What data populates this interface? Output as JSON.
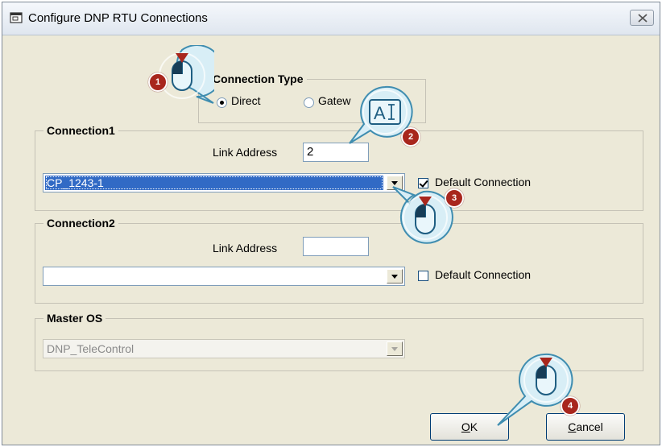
{
  "window": {
    "title": "Configure DNP RTU Connections",
    "title_icon": "dialog-icon",
    "close_icon": "close-icon"
  },
  "connection_type": {
    "legend": "Connection Type",
    "options": [
      {
        "label": "Direct",
        "checked": true
      },
      {
        "label": "Gatew",
        "checked": false
      }
    ]
  },
  "connection1": {
    "legend": "Connection1",
    "link_address_label": "Link Address",
    "link_address_value": "2",
    "combo_value": "CP_1243-1",
    "default_label": "Default Connection",
    "default_checked": true
  },
  "connection2": {
    "legend": "Connection2",
    "link_address_label": "Link Address",
    "link_address_value": "",
    "combo_value": "",
    "default_label": "Default Connection",
    "default_checked": false
  },
  "master_os": {
    "legend": "Master OS",
    "combo_value": "DNP_TeleControl"
  },
  "buttons": {
    "ok_accel": "O",
    "ok_rest": "K",
    "cancel_accel": "C",
    "cancel_rest": "ancel"
  },
  "callouts": [
    {
      "number": "1",
      "icon": "mouse-click-icon"
    },
    {
      "number": "2",
      "icon": "text-input-icon",
      "glyph": "A"
    },
    {
      "number": "3",
      "icon": "mouse-click-icon"
    },
    {
      "number": "4",
      "icon": "mouse-click-icon"
    }
  ],
  "colors": {
    "callout_fill": "#d8eef6",
    "callout_border": "#3f8db0",
    "badge": "#a8261d",
    "selection": "#316ac5"
  }
}
